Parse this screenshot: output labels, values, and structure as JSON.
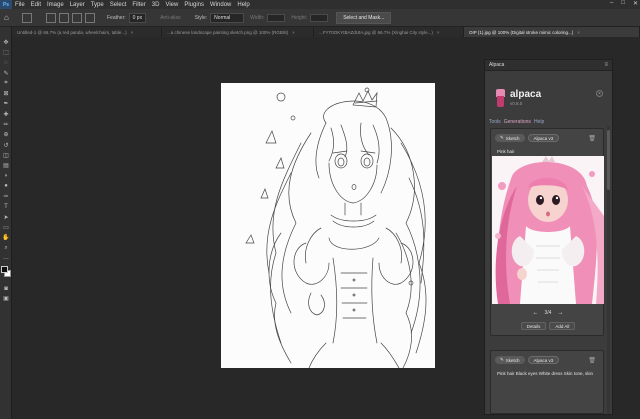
{
  "app": {
    "logo": "Ps"
  },
  "menubar": {
    "items": [
      "File",
      "Edit",
      "Image",
      "Layer",
      "Type",
      "Select",
      "Filter",
      "3D",
      "View",
      "Plugins",
      "Window",
      "Help"
    ]
  },
  "window_controls": {
    "minimize": "–",
    "maximize": "□",
    "close": "✕"
  },
  "optionsbar": {
    "feather_label": "Feather:",
    "feather_value": "0 px",
    "anti_alias_label": "Anti-alias",
    "style_label": "Style:",
    "style_value": "Normal",
    "width_label": "Width:",
    "height_label": "Height:",
    "select_mask_label": "Select and Mask..."
  },
  "tabs": [
    {
      "label": "Untitled-1 @ 66.7% (a red panda, wheelchairs, table...)",
      "active": false
    },
    {
      "label": "...a chinese landscape painting sketch.png @ 100% (RGB/8)",
      "active": false
    },
    {
      "label": "...FYT0OKYtBAZdUtA.jpg @ 66.7% (Xinghai City style...)",
      "active": false
    },
    {
      "label": "OIP (1).jpg @ 100% (Digital stroke mimic coloring...)",
      "active": true
    }
  ],
  "tab_close": "×",
  "tools": [
    "move-tool",
    "marquee-tool",
    "lasso-tool",
    "quick-select-tool",
    "crop-tool",
    "frame-tool",
    "eyedropper-tool",
    "healing-tool",
    "brush-tool",
    "stamp-tool",
    "history-brush-tool",
    "eraser-tool",
    "gradient-tool",
    "blur-tool",
    "dodge-tool",
    "pen-tool",
    "type-tool",
    "path-select-tool",
    "shape-tool",
    "hand-tool",
    "zoom-tool",
    "more-tools"
  ],
  "tool_glyphs": [
    "✥",
    "⬚",
    "◌",
    "✎",
    "⌗",
    "⊠",
    "✒",
    "✚",
    "✏",
    "⊕",
    "↺",
    "◫",
    "▤",
    "◗",
    "●",
    "✑",
    "T",
    "➤",
    "▭",
    "✋",
    "⌕",
    "…"
  ],
  "panel": {
    "tab_label": "Alpaca",
    "menu_icon": "≡",
    "brand_title": "alpaca",
    "brand_version": "v0.8.0",
    "close_glyph": "×",
    "nav": {
      "tools": "Tools",
      "generations": "Generations",
      "help": "Help"
    },
    "cards": [
      {
        "mode_label": "Sketch",
        "model_label": "Alpaca v3",
        "prompt": "Pink hair",
        "page_indicator": "3/4",
        "prev_arrow": "←",
        "next_arrow": "→",
        "details_label": "Details",
        "add_all_label": "Add All"
      },
      {
        "mode_label": "Sketch",
        "model_label": "Alpaca v3",
        "prompt": "Pink hair Black eyes White dress Skin tone, skin"
      }
    ],
    "trash_glyph": "🗑",
    "pencil_glyph": "✎"
  },
  "colors": {
    "accent_pink": "#e58ab3",
    "brand_dark_pink": "#c13b6e",
    "panel_bg": "#3c3c3c",
    "canvas_bg": "#282828"
  }
}
